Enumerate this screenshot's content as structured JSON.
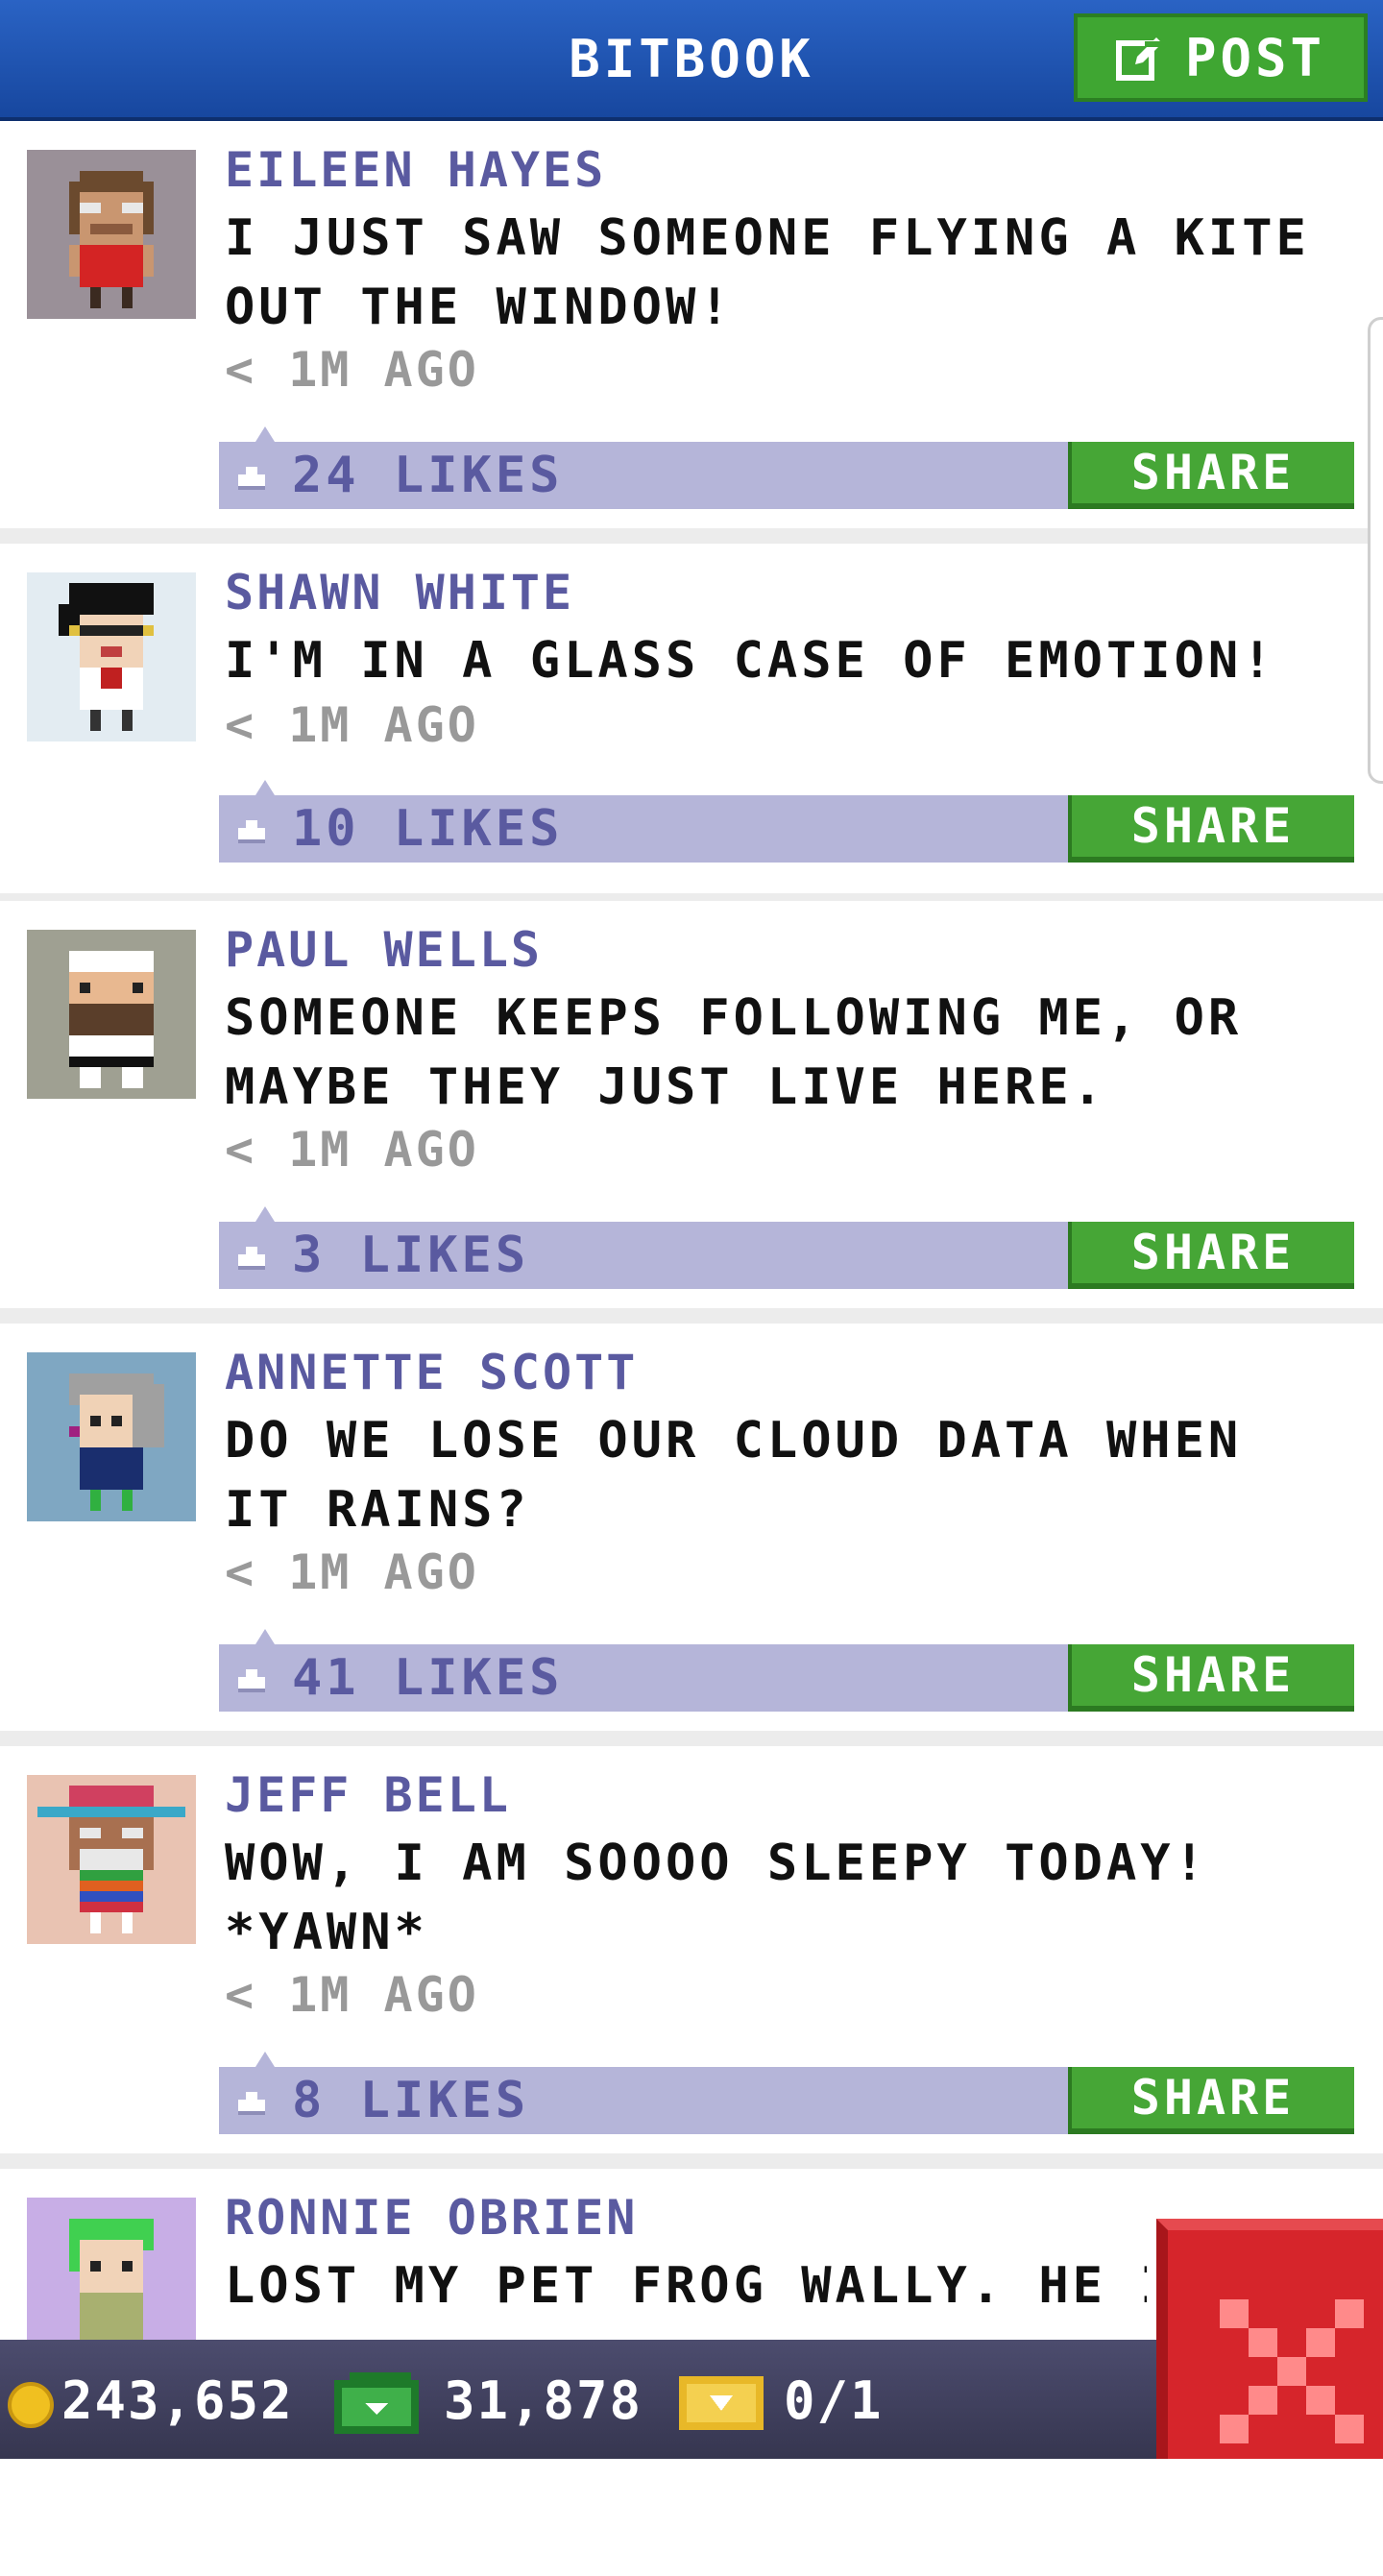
{
  "header": {
    "title": "BITBOOK",
    "post_label": "POST"
  },
  "posts": [
    {
      "author": "EILEEN HAYES",
      "message": "I JUST SAW SOMEONE FLYING A KITE OUT THE WINDOW!",
      "time": "< 1M AGO",
      "likes": "24 LIKES",
      "share": "SHARE",
      "avatar_bg": "#9a9098"
    },
    {
      "author": "SHAWN WHITE",
      "message": "I'M IN A GLASS CASE OF EMOTION!",
      "time": "< 1M AGO",
      "likes": "10 LIKES",
      "share": "SHARE",
      "avatar_bg": "#e3ecf2"
    },
    {
      "author": "PAUL WELLS",
      "message": "SOMEONE KEEPS FOLLOWING ME, OR MAYBE THEY JUST LIVE HERE.",
      "time": "< 1M AGO",
      "likes": "3 LIKES",
      "share": "SHARE",
      "avatar_bg": "#9fa092"
    },
    {
      "author": "ANNETTE SCOTT",
      "message": "DO WE LOSE OUR CLOUD DATA WHEN IT RAINS?",
      "time": "< 1M AGO",
      "likes": "41 LIKES",
      "share": "SHARE",
      "avatar_bg": "#7fa7c2"
    },
    {
      "author": "JEFF BELL",
      "message": "WOW, I AM SOOOO SLEEPY TODAY! *YAWN*",
      "time": "< 1M AGO",
      "likes": "8 LIKES",
      "share": "SHARE",
      "avatar_bg": "#e9c3b2"
    },
    {
      "author": "RONNIE OBRIEN",
      "message": "LOST MY PET FROG WALLY. HE IS",
      "avatar_bg": "#c8aee6"
    }
  ],
  "footer": {
    "coins": "243,652",
    "bux": "31,878",
    "tickets": "0/1"
  },
  "colors": {
    "header_blue": "#1f53b0",
    "share_green": "#46a636",
    "like_bar": "#b5b5d9",
    "author_purple": "#5a5aa0",
    "close_red": "#d6252b"
  }
}
